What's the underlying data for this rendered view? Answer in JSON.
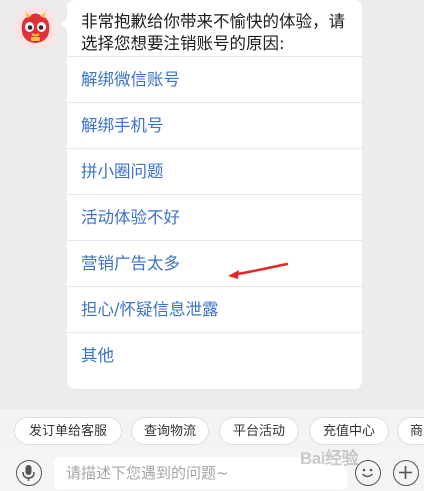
{
  "message": {
    "intro": "非常抱歉给你带来不愉快的体验，请选择您想要注销账号的原因:",
    "options": [
      "解绑微信账号",
      "解绑手机号",
      "拼小圈问题",
      "活动体验不好",
      "营销广告太多",
      "担心/怀疑信息泄露",
      "其他"
    ]
  },
  "quick_replies": [
    "发订单给客服",
    "查询物流",
    "平台活动",
    "充值中心",
    "商"
  ],
  "input": {
    "placeholder": "请描述下您遇到的问题~"
  },
  "watermark": "Bai经验",
  "colors": {
    "link": "#3b73c9",
    "annotation_arrow": "#e02a2a",
    "background": "#ececec"
  },
  "icons": {
    "voice": "microphone-icon",
    "emoji": "smiley-icon",
    "more": "plus-icon"
  }
}
